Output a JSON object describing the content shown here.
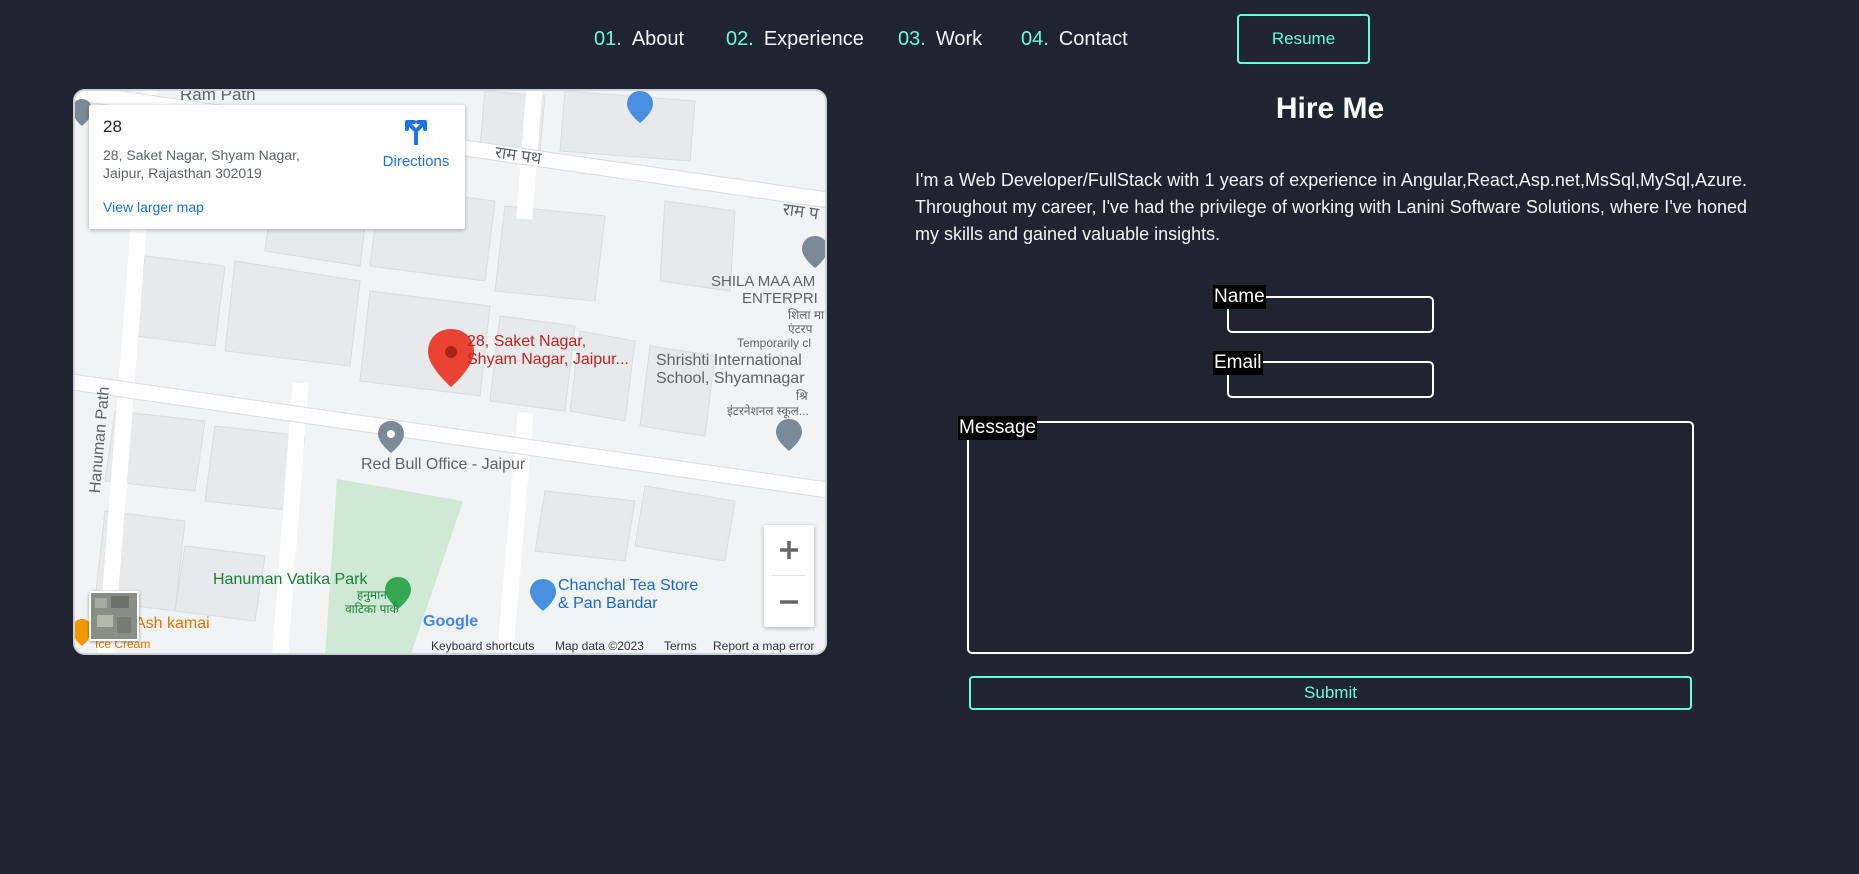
{
  "nav": {
    "items": [
      {
        "num": "01.",
        "label": "About"
      },
      {
        "num": "02.",
        "label": "Experience"
      },
      {
        "num": "03.",
        "label": "Work"
      },
      {
        "num": "04.",
        "label": "Contact"
      }
    ],
    "resume_label": "Resume"
  },
  "map": {
    "place_card": {
      "title": "28",
      "address_line1": "28, Saket Nagar, Shyam Nagar,",
      "address_line2": "Jaipur, Rajasthan 302019",
      "directions_label": "Directions",
      "view_larger_label": "View larger map"
    },
    "labels": {
      "ram_path_top": "Ram Path",
      "ram_path_hi": "राम पथ",
      "ram_path_hi_right": "राम प",
      "marker_line1": "28, Saket Nagar,",
      "marker_line2": "Shyam Nagar, Jaipur...",
      "shila_line1": "SHILA MAA AM",
      "shila_line2": "ENTERPRI",
      "shila_hi1": "शिला मा",
      "shila_hi2": "एंटरप",
      "temporarily": "Temporarily cl",
      "shrishti_line1": "Shrishti International",
      "shrishti_line2": "School, Shyamnagar",
      "shrishti_hi1": "श्रि",
      "shrishti_hi2": "इंटरनेशनल स्कूल...",
      "redbull": "Red Bull Office - Jaipur",
      "hanuman_path": "Hanuman Path",
      "hanuman_park": "Hanuman Vatika Park",
      "hanuman_park_hi1": "हनुमान",
      "hanuman_park_hi2": "वाटिका पार्क",
      "chanchal_line1": "Chanchal Tea Store",
      "chanchal_line2": "& Pan Bandar",
      "kamal": "Ash kamai",
      "ice_cream": "Ice Cream",
      "google": "Google"
    },
    "footer": {
      "keyboard": "Keyboard shortcuts",
      "map_data": "Map data ©2023",
      "terms": "Terms",
      "report": "Report a map error"
    },
    "zoom_in": "+",
    "zoom_out": "−"
  },
  "hire": {
    "title": "Hire Me",
    "text": "I'm a Web Developer/FullStack with 1 years of experience in Angular,React,Asp.net,MsSql,MySql,Azure. Throughout my career, I've had the privilege of working with Lanini Software Solutions, where I've honed my skills and gained valuable insights.",
    "name_label": "Name",
    "email_label": "Email",
    "message_label": "Message",
    "name_value": "",
    "email_value": "",
    "message_value": "",
    "submit_label": "Submit"
  },
  "colors": {
    "background": "#1f2430",
    "accent": "#64ffda",
    "text": "#ffffff"
  }
}
